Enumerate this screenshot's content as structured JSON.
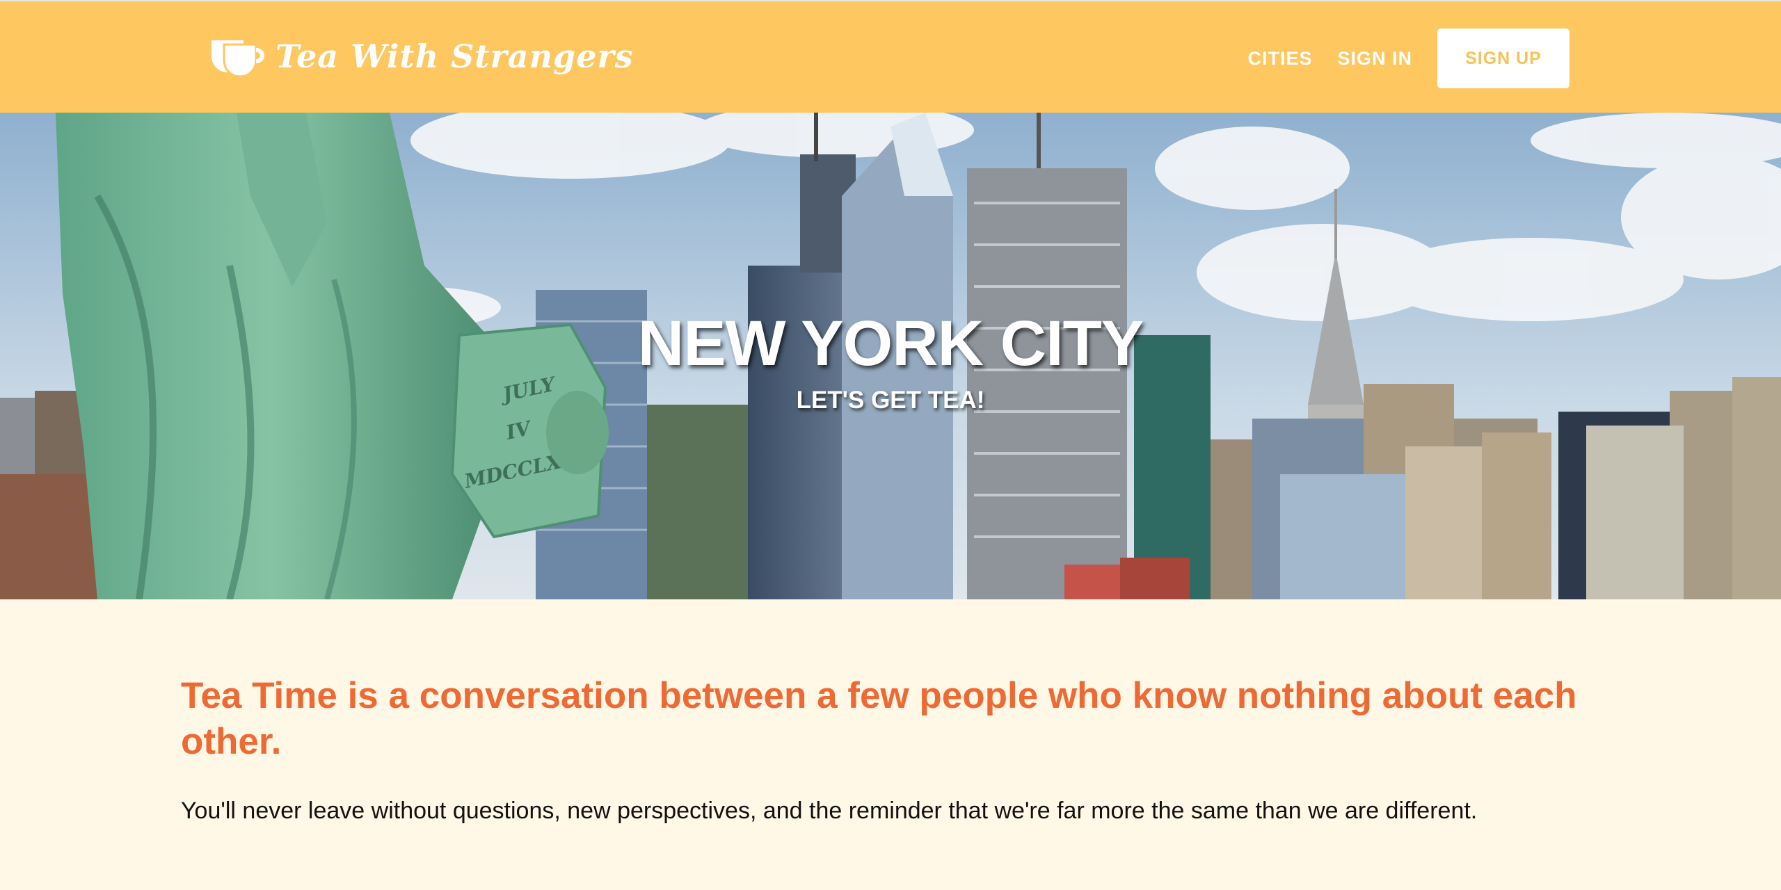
{
  "header": {
    "brand_name": "Tea With Strangers",
    "logo_icon": "tea-cups-icon",
    "nav": {
      "cities_label": "CITIES",
      "signin_label": "SIGN IN",
      "signup_label": "SIGN UP"
    },
    "background_color": "#fec75f"
  },
  "hero": {
    "title": "NEW YORK CITY",
    "subtitle": "LET'S GET TEA!",
    "statue_tablet_text": [
      "JULY",
      "IV",
      "MDCCLXXVI"
    ]
  },
  "content": {
    "headline": "Tea Time is a conversation between a few people who know nothing about each other.",
    "body": "You'll never leave without questions, new perspectives, and the reminder that we're far more the same than we are different.",
    "headline_color": "#ee6a34",
    "background_color": "#fff8e6"
  }
}
